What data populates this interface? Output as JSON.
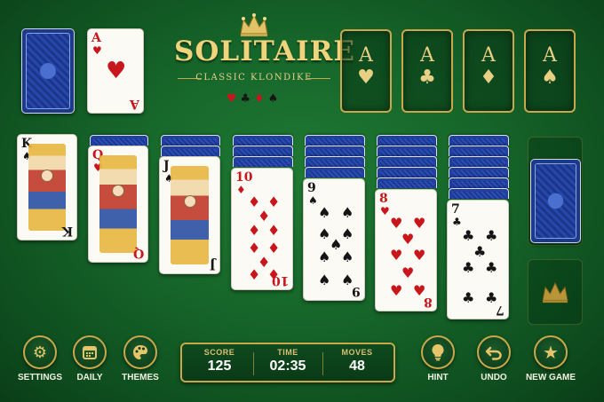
{
  "title": "SOLITAIRE",
  "subtitle": "CLASSIC KLONDIKE",
  "title_suits": {
    "hearts": "♥",
    "clubs": "♣",
    "diamonds": "♦",
    "spades": "♠"
  },
  "waste_card": {
    "rank": "A",
    "suit": "♥"
  },
  "foundations": [
    {
      "rank": "A",
      "suit": "♥"
    },
    {
      "rank": "A",
      "suit": "♣"
    },
    {
      "rank": "A",
      "suit": "♦"
    },
    {
      "rank": "A",
      "suit": "♠"
    }
  ],
  "tableau": [
    {
      "rank": "K",
      "suit": "♠",
      "color": "black",
      "face_down": 0
    },
    {
      "rank": "Q",
      "suit": "♥",
      "color": "red",
      "face_down": 1
    },
    {
      "rank": "J",
      "suit": "♠",
      "color": "black",
      "face_down": 2
    },
    {
      "rank": "10",
      "suit": "♦",
      "color": "red",
      "face_down": 3
    },
    {
      "rank": "9",
      "suit": "♠",
      "color": "black",
      "face_down": 4
    },
    {
      "rank": "8",
      "suit": "♥",
      "color": "red",
      "face_down": 5
    },
    {
      "rank": "7",
      "suit": "♣",
      "color": "black",
      "face_down": 6
    }
  ],
  "buttons": {
    "settings": "SETTINGS",
    "daily": "DAILY",
    "themes": "THEMES",
    "hint": "HINT",
    "undo": "UNDO",
    "new_game": "NEW GAME"
  },
  "icons": {
    "settings": "gear-icon",
    "daily": "calendar-icon",
    "themes": "palette-icon",
    "hint": "lightbulb-icon",
    "undo": "undo-icon",
    "new_game": "star-icon"
  },
  "stats": {
    "score_label": "SCORE",
    "score": "125",
    "time_label": "TIME",
    "time": "02:35",
    "moves_label": "MOVES",
    "moves": "48"
  },
  "colors": {
    "felt": "#16652a",
    "gold": "#c9a84c",
    "card_back": "#1c3a8c",
    "red_suit": "#c8161d",
    "black_suit": "#151515"
  }
}
